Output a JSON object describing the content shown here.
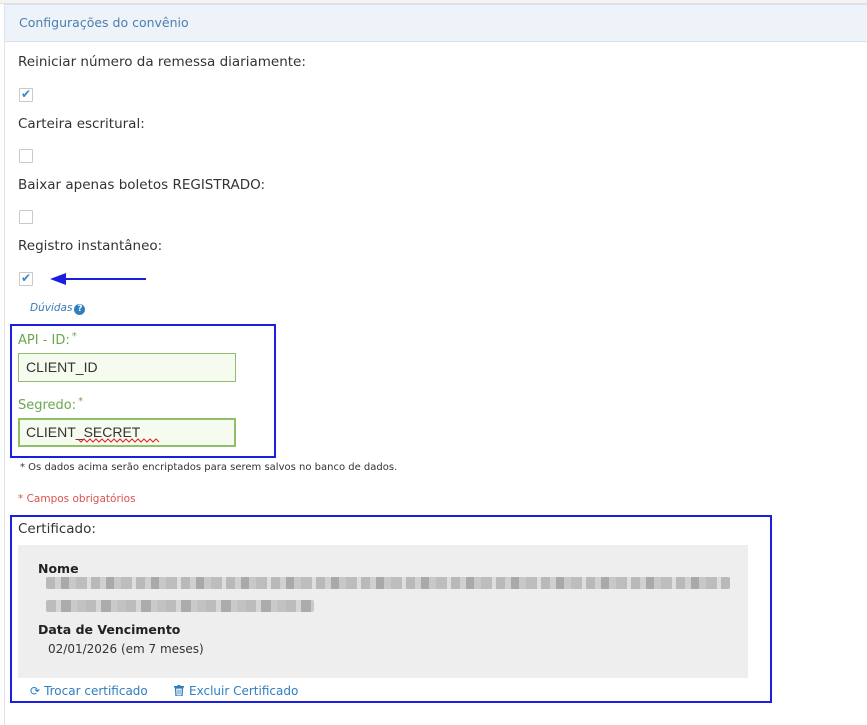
{
  "panel": {
    "title": "Configurações do convênio"
  },
  "settings": {
    "reiniciar": {
      "label": "Reiniciar número da remessa diariamente:",
      "checked": true
    },
    "carteira": {
      "label": "Carteira escritural:",
      "checked": false
    },
    "baixar": {
      "label": "Baixar apenas boletos REGISTRADO:",
      "checked": false
    },
    "registro": {
      "label": "Registro instantâneo:",
      "checked": true
    }
  },
  "help": {
    "label": "Dúvidas",
    "icon": "question-circle-icon"
  },
  "api": {
    "id_label": "API - ID:",
    "id_value": "CLIENT_ID",
    "secret_label": "Segredo:",
    "secret_value": "CLIENT_SECRET",
    "required_mark": "*"
  },
  "notes": {
    "encrypted": "* Os dados acima serão encriptados para serem salvos no banco de dados.",
    "required": "* Campos obrigatórios"
  },
  "certificate": {
    "title": "Certificado:",
    "name_label": "Nome",
    "expiry_label": "Data de Vencimento",
    "expiry_value": "02/01/2026 (em 7 meses)",
    "change_label": "Trocar certificado",
    "delete_label": "Excluir Certificado"
  },
  "colors": {
    "accent": "#2f7ec0",
    "highlight_box": "#1a1ee0",
    "required": "#d9534f",
    "field_border": "#8fbf6a"
  }
}
